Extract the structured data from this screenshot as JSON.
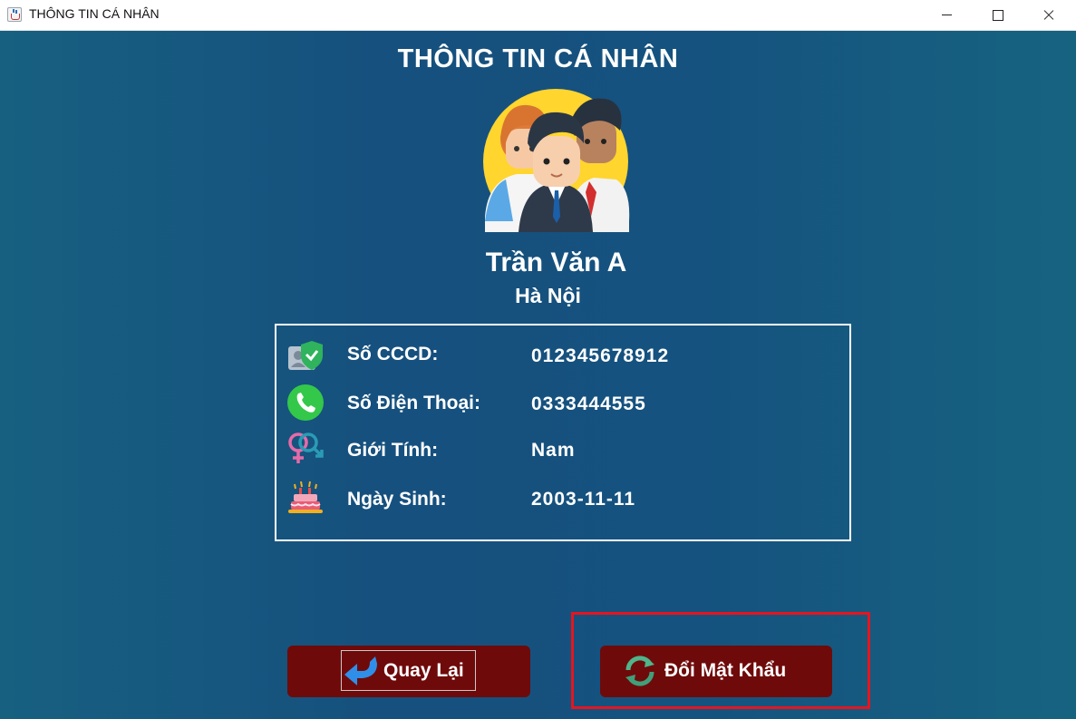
{
  "window": {
    "title": "THÔNG TIN CÁ NHÂN"
  },
  "heading": "THÔNG TIN CÁ NHÂN",
  "profile": {
    "name": "Trần Văn A",
    "city": "Hà Nội"
  },
  "info_rows": [
    {
      "label": "Số CCCD:",
      "value": "012345678912",
      "icon": "id-card-shield-icon"
    },
    {
      "label": "Số Điện Thoại:",
      "value": "0333444555",
      "icon": "phone-icon"
    },
    {
      "label": "Giới Tính:",
      "value": "Nam",
      "icon": "gender-icon"
    },
    {
      "label": "Ngày Sinh:",
      "value": "2003-11-11",
      "icon": "birthday-cake-icon"
    }
  ],
  "buttons": {
    "back_label": "Quay Lại",
    "change_password_label": "Đổi Mật Khẩu"
  },
  "colors": {
    "background": "#15527f",
    "button": "#6f0a0a",
    "highlight": "#e8141e",
    "text": "#ffffff"
  }
}
